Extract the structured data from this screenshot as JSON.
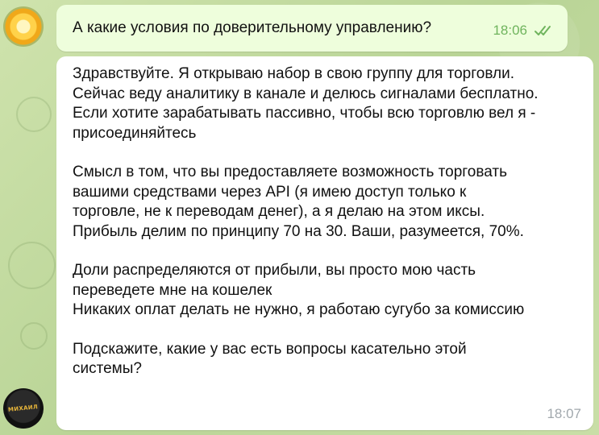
{
  "chat": {
    "outgoing": {
      "text": "А какие условия по доверительному управлению?",
      "time": "18:06",
      "status_icon": "double-check-icon"
    },
    "incoming": {
      "paragraphs": [
        "Здравствуйте. Я открываю набор в свою группу для торговли.\nСейчас веду аналитику в канале и делюсь сигналами бесплатно.\nЕсли хотите зарабатывать пассивно, чтобы всю торговлю вел я -\nприсоединяйтесь",
        "Смысл в том, что вы предоставляете возможность торговать\nвашими средствами через API (я имею доступ только к\nторговле, не к переводам денег), а я делаю на этом иксы.\nПрибыль делим по принципу 70 на 30. Ваши, разумеется, 70%.",
        "Доли распределяются от прибыли, вы просто мою часть\nпереведете мне на кошелек\nНикаких оплат делать не нужно, я работаю сугубо за комиссию",
        "Подскажите, какие у вас есть вопросы касательно этой\nсистемы?"
      ],
      "time": "18:07"
    },
    "avatar_bottom_label": "МИХАИЛ"
  },
  "colors": {
    "chat_background": "#c5dca6",
    "outgoing_bubble": "#eefedc",
    "incoming_bubble": "#ffffff",
    "outgoing_time": "#6fb45d",
    "incoming_time": "#a1a8ad"
  }
}
